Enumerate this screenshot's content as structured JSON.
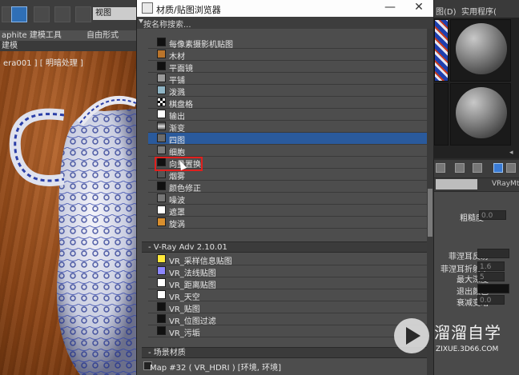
{
  "toolbar": {
    "viewport_dropdown": "视图"
  },
  "ribbon": {
    "tab_modeling": "aphite 建模工具",
    "tab_freeform": "自由形式"
  },
  "viewport": {
    "sublabel": "建模",
    "caption": "era001 ] [ 明暗处理 ]"
  },
  "dialog": {
    "title": "材质/贴图浏览器",
    "search_placeholder": "按名称搜索...",
    "minimize_glyph": "—",
    "close_glyph": "✕",
    "standard_maps": [
      {
        "label": "每像素摄影机贴图",
        "swatch": "#111111"
      },
      {
        "label": "木材",
        "swatch": "#b9742b"
      },
      {
        "label": "平面镜",
        "swatch": "#111111"
      },
      {
        "label": "平铺",
        "swatch": "#9a9a9a"
      },
      {
        "label": "泼溅",
        "swatch": "#8fb4c4"
      },
      {
        "label": "棋盘格",
        "swatch": "checker"
      },
      {
        "label": "输出",
        "swatch": "#ffffff"
      },
      {
        "label": "渐变",
        "swatch": "gradient"
      },
      {
        "label": "四图",
        "swatch": "#6c6c6c"
      },
      {
        "label": "细胞",
        "swatch": "#7d7d7d"
      },
      {
        "label": "向量置换",
        "swatch": "#111111"
      },
      {
        "label": "烟雾",
        "swatch": "#555555"
      },
      {
        "label": "颜色修正",
        "swatch": "#111111"
      },
      {
        "label": "噪波",
        "swatch": "#777777"
      },
      {
        "label": "遮罩",
        "swatch": "#ffffff"
      },
      {
        "label": "旋涡",
        "swatch": "#d98f2e"
      }
    ],
    "vray_group": "- V-Ray Adv 2.10.01",
    "vray_maps": [
      {
        "label": "VR_采样信息贴图",
        "swatch": "#ffe83a"
      },
      {
        "label": "VR_法线贴图",
        "swatch": "#8c86ff"
      },
      {
        "label": "VR_距离贴图",
        "swatch": "#ffffff"
      },
      {
        "label": "VR_天空",
        "swatch": "#ffffff"
      },
      {
        "label": "VR_贴图",
        "swatch": "#111111"
      },
      {
        "label": "VR_位图过滤",
        "swatch": "#111111"
      },
      {
        "label": "VR_污垢",
        "swatch": "#111111"
      }
    ],
    "scene_group": "- 场景材质",
    "scene_item": "Map #32 ( VR_HDRI ) [环境, 环境]"
  },
  "right_panel": {
    "menu_left": "图(D)",
    "menu_right": "实用程序(",
    "material_name": "VRayMtl",
    "params": [
      {
        "label": "粗糙度",
        "value": "0.0"
      },
      {
        "label": "菲涅耳反射",
        "value": ""
      },
      {
        "label": "菲涅耳折射率",
        "value": "1.6"
      },
      {
        "label": "最大深度",
        "value": "5"
      },
      {
        "label": "退出颜色",
        "value": ""
      },
      {
        "label": "衰减变暗",
        "value": "0.0"
      }
    ]
  },
  "watermark": {
    "brand": "溜溜自学",
    "url": "ZIXUE.3D66.COM"
  },
  "colors": {
    "selection": "#2a5a9c",
    "highlight_box": "#e0201e",
    "title_bar": "#fdfdfd"
  }
}
